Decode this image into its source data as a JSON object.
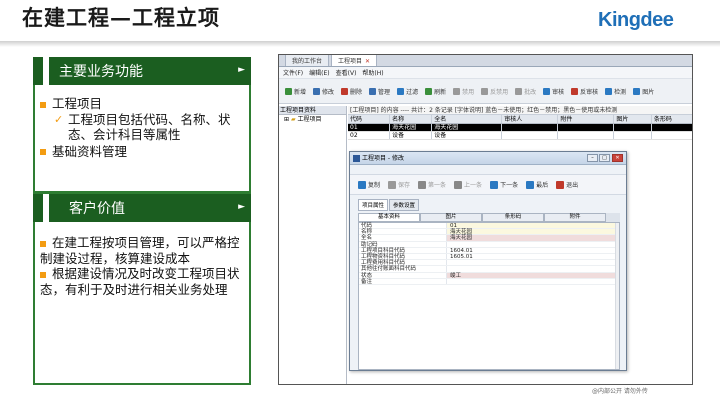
{
  "slide": {
    "title": "在建工程—工程立项",
    "logo": "Kingdee",
    "footer": "@内部公开 请勿外传"
  },
  "left": {
    "section1": {
      "heading": "主要业务功能",
      "items": [
        {
          "label": "工程项目",
          "sub": "工程项目包括代码、名称、状态、会计科目等属性"
        },
        {
          "label": "基础资料管理"
        }
      ]
    },
    "section2": {
      "heading": "客户价值",
      "items": [
        "在建工程按项目管理，可以严格控制建设过程，核算建设成本",
        "根据建设情况及时改变工程项目状态，有利于及时进行相关业务处理"
      ]
    }
  },
  "app": {
    "tabs": [
      "我的工作台",
      "工程项目"
    ],
    "tab_close": "✕",
    "menu": [
      "文件(F)",
      "编辑(E)",
      "查看(V)",
      "帮助(H)"
    ],
    "toolbar": [
      {
        "label": "新增",
        "color": "#3a8f3a",
        "disabled": false
      },
      {
        "label": "修改",
        "color": "#3a6fb0",
        "disabled": false
      },
      {
        "label": "删除",
        "color": "#c0392b",
        "disabled": false
      },
      {
        "label": "管理",
        "color": "#3a6fb0",
        "disabled": false
      },
      {
        "label": "过滤",
        "color": "#2b79c2",
        "disabled": false
      },
      {
        "label": "刷新",
        "color": "#3a8f3a",
        "disabled": false
      },
      {
        "label": "禁用",
        "color": "#999999",
        "disabled": true
      },
      {
        "label": "反禁用",
        "color": "#999999",
        "disabled": true
      },
      {
        "label": "批改",
        "color": "#999999",
        "disabled": true
      },
      {
        "label": "审核",
        "color": "#2b79c2",
        "disabled": false
      },
      {
        "label": "反审核",
        "color": "#c0392b",
        "disabled": false
      },
      {
        "label": "检测",
        "color": "#2b79c2",
        "disabled": false
      },
      {
        "label": "图片",
        "color": "#2b79c2",
        "disabled": false
      }
    ],
    "tree": {
      "header": "工程项目资料",
      "node": "工程项目"
    },
    "grid": {
      "info": "[工程项目] 的内容 ---- 共计：2 条记录 [字体说明] 蓝色－未使用；红色－禁用；黑色－使用或未检测",
      "columns": [
        "代码",
        "名称",
        "全名",
        "审核人",
        "附件",
        "图片",
        "条形码"
      ],
      "rows": [
        [
          "01",
          "海天花园",
          "海天花园",
          "",
          "",
          "",
          ""
        ],
        [
          "02",
          "设备",
          "设备",
          "",
          "",
          "",
          ""
        ]
      ]
    },
    "dialog": {
      "title": "工程项目 - 修改",
      "buttons": [
        "复制",
        "保存",
        "第一条",
        "上一条",
        "下一条",
        "最后",
        "退出"
      ],
      "tabs": [
        "项目属性",
        "参数设置"
      ],
      "subtabs": [
        "基本资料",
        "图片",
        "条形码",
        "附件"
      ],
      "fields": [
        {
          "label": "代码",
          "value": "01",
          "style": "yel"
        },
        {
          "label": "名称",
          "value": "海天花园",
          "style": "yel"
        },
        {
          "label": "全名",
          "value": "海天花园",
          "style": "pink"
        },
        {
          "label": "助记码",
          "value": "",
          "style": ""
        },
        {
          "label": "工程项目科目代码",
          "value": "1604.01",
          "style": ""
        },
        {
          "label": "工程物资科目代码",
          "value": "1605.01",
          "style": ""
        },
        {
          "label": "工程费用科目代码",
          "value": "",
          "style": ""
        },
        {
          "label": "其他往付账面科目代码",
          "value": "",
          "style": ""
        },
        {
          "label": "状态",
          "value": "竣工",
          "style": "pink"
        },
        {
          "label": "备注",
          "value": "",
          "style": ""
        }
      ]
    }
  }
}
